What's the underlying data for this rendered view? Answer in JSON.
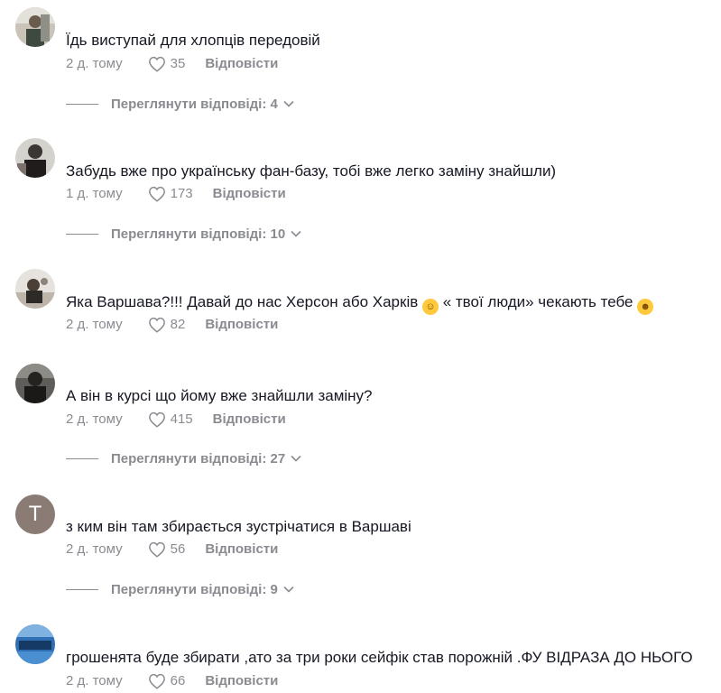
{
  "comments": [
    {
      "avatar": "user-photo-avatar",
      "text": "Їдь виступай для хлопців передовій",
      "time": "2 д. тому",
      "likes": "35",
      "reply": "Відповісти",
      "view_replies": "Переглянути відповіді: 4"
    },
    {
      "avatar": "user-photo-avatar",
      "text": "Забудь вже про українську фан-базу, тобі вже легко заміну знайшли)",
      "time": "1 д. тому",
      "likes": "173",
      "reply": "Відповісти",
      "view_replies": "Переглянути відповіді: 10"
    },
    {
      "avatar": "user-photo-avatar",
      "text_parts": [
        "Яка Варшава?!!! Давай до нас Херсон або Харків ",
        " « твої люди» чекають тебе "
      ],
      "emojis": [
        "smiling-face-emoji",
        "grinning-face-emoji"
      ],
      "time": "2 д. тому",
      "likes": "82",
      "reply": "Відповісти"
    },
    {
      "avatar": "user-photo-avatar",
      "text": "А він в курсі що йому вже знайшли заміну?",
      "time": "2 д. тому",
      "likes": "415",
      "reply": "Відповісти",
      "view_replies": "Переглянути відповіді: 27"
    },
    {
      "avatar_letter": "T",
      "avatar_color": "#8a7c74",
      "text": "з ким він там збирається зустрічатися в Варшаві",
      "time": "2 д. тому",
      "likes": "56",
      "reply": "Відповісти",
      "view_replies": "Переглянути відповіді: 9"
    },
    {
      "avatar": "user-photo-avatar",
      "text": "грошенята буде збирати ,ато за три роки сейфік став порожній .ФУ ВІДРАЗА ДО НЬОГО",
      "time": "2 д. тому",
      "likes": "66",
      "reply": "Відповісти"
    }
  ],
  "colors": {
    "text": "#161823",
    "muted": "#8a8b91"
  },
  "icons": [
    "heart-outline-icon",
    "chevron-down-icon"
  ]
}
